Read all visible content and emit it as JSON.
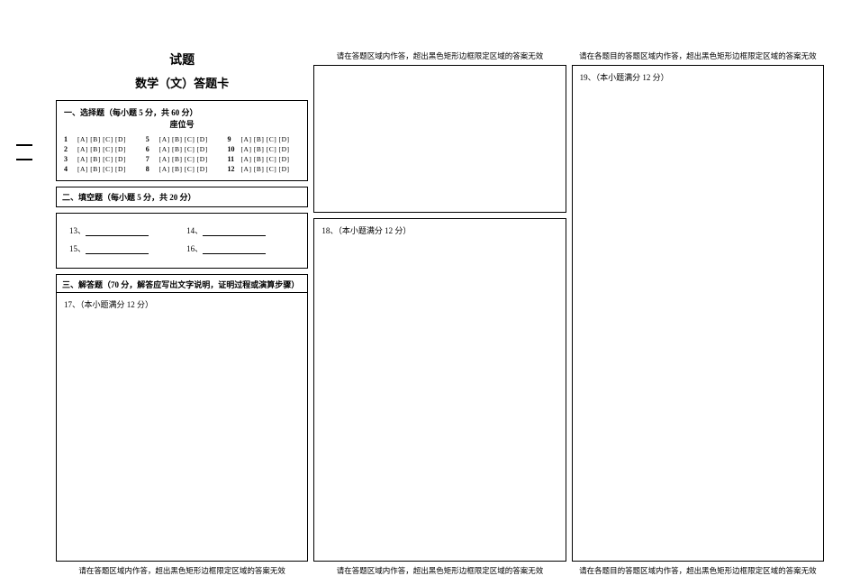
{
  "col1": {
    "heading_super": "试题",
    "heading_main": "数学（文）答题卡",
    "section1_title": "一、选择题（每小题 5 分，共 60 分）",
    "seat_label": "座位号",
    "mc": {
      "opts": "[A] [B] [C] [D]",
      "nums": [
        "1",
        "2",
        "3",
        "4",
        "5",
        "6",
        "7",
        "8",
        "9",
        "10",
        "11",
        "12"
      ]
    },
    "section2_title": "二、填空题（每小题 5 分，共 20 分）",
    "fill_labels": [
      "13、",
      "14、",
      "15、",
      "16、"
    ],
    "section3_title": "三、解答题（70 分，解答应写出文字说明，证明过程或演算步骤）",
    "q17": "17、（本小题满分 12 分）"
  },
  "col2": {
    "q18": "18、（本小题满分 12 分）"
  },
  "col3": {
    "q19": "19、（本小题满分 12 分）"
  },
  "warn1": "请在答题区域内作答，超出黑色矩形边框限定区域的答案无效",
  "warn2": "请在各题目的答题区域内作答，超出黑色矩形边框限定区域的答案无效"
}
